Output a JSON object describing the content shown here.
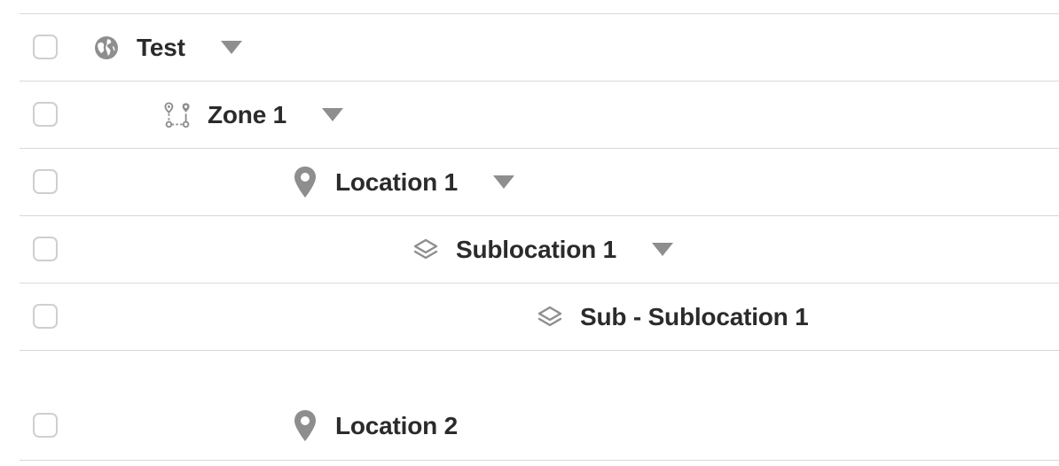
{
  "tree": {
    "rows": [
      {
        "label": "Test",
        "icon": "globe-icon",
        "has_caret": true
      },
      {
        "label": "Zone 1",
        "icon": "zone-route-icon",
        "has_caret": true
      },
      {
        "label": "Location 1",
        "icon": "map-pin-icon",
        "has_caret": true
      },
      {
        "label": "Sublocation 1",
        "icon": "layers-icon",
        "has_caret": true
      },
      {
        "label": "Sub - Sublocation 1",
        "icon": "layers-icon",
        "has_caret": false
      },
      {
        "label": "Location 2",
        "icon": "map-pin-icon",
        "has_caret": false
      }
    ]
  },
  "colors": {
    "text": "#2b2b2b",
    "icon": "#8e8e8e",
    "border": "#d9d9d9",
    "checkbox_border": "#cfcfcf"
  }
}
